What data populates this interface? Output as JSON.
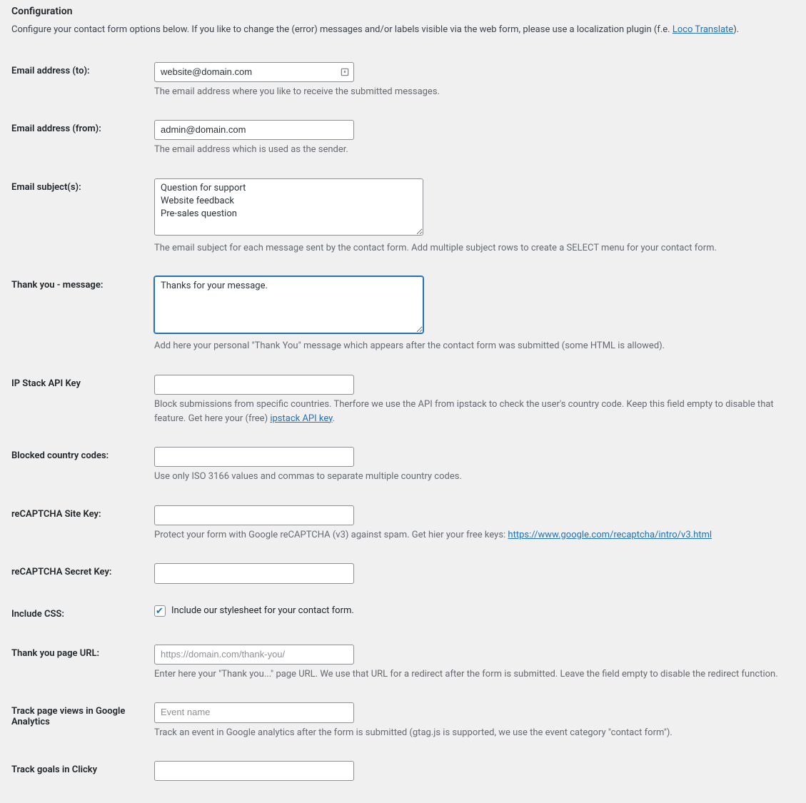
{
  "title": "Configuration",
  "intro_prefix": "Configure your contact form options below. If you like to change the (error) messages and/or labels visible via the web form, please use a localization plugin (f.e. ",
  "intro_link": "Loco Translate",
  "intro_suffix": ").",
  "fields": {
    "emailTo": {
      "label": "Email address (to):",
      "value": "website@domain.com",
      "helper": "The email address where you like to receive the submitted messages."
    },
    "emailFrom": {
      "label": "Email address (from):",
      "value": "admin@domain.com",
      "helper": "The email address which is used as the sender."
    },
    "subjects": {
      "label": "Email subject(s):",
      "value": "Question for support\nWebsite feedback\nPre-sales question",
      "helper": "The email subject for each message sent by the contact form. Add multiple subject rows to create a SELECT menu for your contact form."
    },
    "thankYou": {
      "label": "Thank you - message:",
      "value": "Thanks for your message.",
      "helper": "Add here your personal \"Thank You\" message which appears after the contact form was submitted (some HTML is allowed)."
    },
    "ipstack": {
      "label": "IP Stack API Key",
      "value": "",
      "helper_prefix": "Block submissions from specific countries. Therfore we use the API from ipstack to check the user's country code. Keep this field empty to disable that feature. Get here your (free) ",
      "helper_link": "ipstack API key",
      "helper_suffix": "."
    },
    "blockedCountries": {
      "label": "Blocked country codes:",
      "value": "",
      "helper": "Use only ISO 3166 values and commas to separate multiple country codes."
    },
    "recaptchaSite": {
      "label": "reCAPTCHA Site Key:",
      "value": "",
      "helper_prefix": "Protect your form with Google reCAPTCHA (v3) against spam. Get hier your free keys: ",
      "helper_link": "https://www.google.com/recaptcha/intro/v3.html"
    },
    "recaptchaSecret": {
      "label": "reCAPTCHA Secret Key:",
      "value": ""
    },
    "includeCss": {
      "label": "Include CSS:",
      "checkboxLabel": "Include our stylesheet for your contact form."
    },
    "thankYouUrl": {
      "label": "Thank you page URL:",
      "placeholder": "https://domain.com/thank-you/",
      "value": "",
      "helper": "Enter here your \"Thank you...\" page URL. We use that URL for a redirect after the form is submitted. Leave the field empty to disable the redirect function."
    },
    "gaEvent": {
      "label": "Track page views in Google Analytics",
      "placeholder": "Event name",
      "value": "",
      "helper": "Track an event in Google analytics after the form is submitted (gtag.js is supported, we use the event category \"contact form\")."
    },
    "clicky": {
      "label": "Track goals in Clicky",
      "value": ""
    }
  }
}
